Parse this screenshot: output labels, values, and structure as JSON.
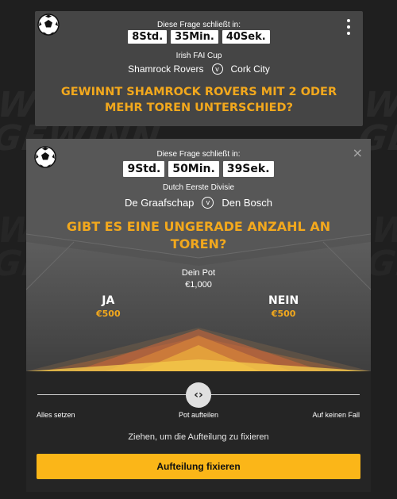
{
  "background": {
    "slogan_line1": "WETTE DEN",
    "slogan_line2": "GEWINN"
  },
  "top_card": {
    "closes_label": "Diese Frage schließt in:",
    "timer": {
      "hours": "8Std.",
      "minutes": "35Min.",
      "seconds": "40Sek."
    },
    "competition": "Irish FAI Cup",
    "home_team": "Shamrock Rovers",
    "vs_label": "v",
    "away_team": "Cork City",
    "question": "GEWINNT SHAMROCK ROVERS MIT 2 ODER MEHR TOREN UNTERSCHIED?"
  },
  "main_card": {
    "closes_label": "Diese Frage schließt in:",
    "timer": {
      "hours": "9Std.",
      "minutes": "50Min.",
      "seconds": "39Sek."
    },
    "competition": "Dutch Eerste Divisie",
    "home_team": "De Graafschap",
    "vs_label": "v",
    "away_team": "Den Bosch",
    "question": "GIBT ES EINE UNGERADE ANZAHL AN TOREN?",
    "pot_label": "Dein Pot",
    "pot_value": "€1,000",
    "yes": {
      "label": "JA",
      "amount": "€500"
    },
    "no": {
      "label": "NEIN",
      "amount": "€500"
    },
    "close_glyph": "×"
  },
  "split_panel": {
    "handle_glyph": "‹›",
    "label_left": "Alles setzen",
    "label_center": "Pot aufteilen",
    "label_right": "Auf keinen Fall",
    "split_fraction": 0.5,
    "hint": "Ziehen, um die Aufteilung zu fixieren",
    "confirm_button": "Aufteilung fixieren"
  },
  "colors": {
    "accent_orange": "#f2a81d",
    "button_yellow": "#fbb618",
    "card_top": "#454545",
    "card_main": "#575757",
    "page_bg": "#1f1f1f"
  },
  "icons": [
    "soccer-ball-icon",
    "kebab-menu-icon",
    "close-icon",
    "chevrons-left-right-icon"
  ]
}
